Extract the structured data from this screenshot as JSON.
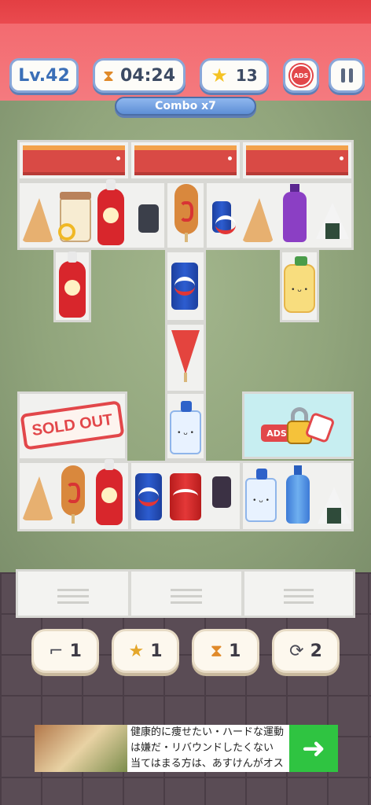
{
  "hud": {
    "level": "Lv.42",
    "timer": "04:24",
    "stars": "13",
    "ads_label": "ADS",
    "combo": "Combo x7"
  },
  "shelves": {
    "sold_out": "SOLD OUT",
    "locked_ads_label": "ADS"
  },
  "boosters": [
    {
      "name": "boot-booster",
      "icon": "boot-icon",
      "glyph": "⌐",
      "count": "1"
    },
    {
      "name": "magic-wand-booster",
      "icon": "magic-wand-icon",
      "glyph": "★",
      "count": "1"
    },
    {
      "name": "hourglass-booster",
      "icon": "hourglass-icon",
      "glyph": "⧗",
      "count": "1"
    },
    {
      "name": "shuffle-booster",
      "icon": "shuffle-icon",
      "glyph": "⟳",
      "count": "2"
    }
  ],
  "ad": {
    "text": "健康的に痩せたい・ハードな運動は嫌だ・リバウンドしたくない 当てはまる方は、あすけんがオススメ！まずは栄...",
    "cta_glyph": "➜"
  },
  "colors": {
    "accent_red": "#e33f43",
    "hud_border": "#8aa7d8",
    "ad_green": "#2fc441"
  }
}
